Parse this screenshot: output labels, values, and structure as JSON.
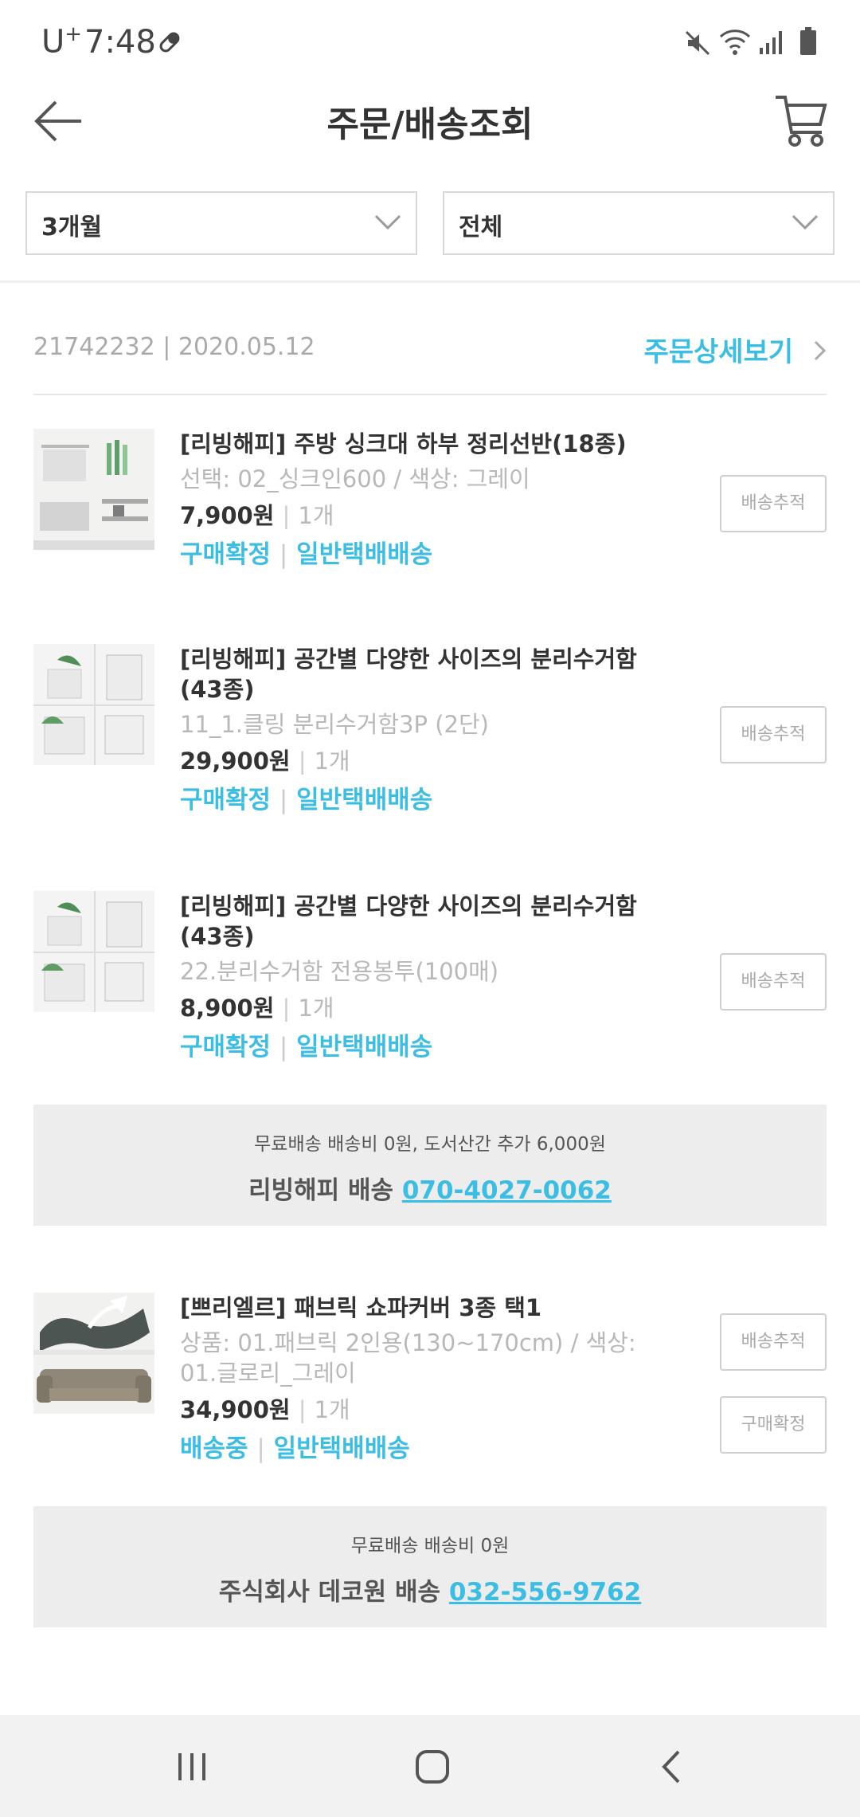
{
  "status_bar": {
    "carrier": "U",
    "carrier_sup": "+",
    "time": "7:48"
  },
  "header": {
    "title": "주문/배송조회"
  },
  "filters": {
    "period": "3개월",
    "type": "전체"
  },
  "order": {
    "info": "21742232 | 2020.05.12",
    "detail_link": "주문상세보기"
  },
  "items": [
    {
      "name": "[리빙해피] 주방 싱크대 하부 정리선반(18종)",
      "name2": "",
      "option": "선택: 02_싱크인600 / 색상: 그레이",
      "option2": "",
      "price": "7,900원",
      "qty": "1개",
      "status": "구매확정",
      "ship": "일반택배배송",
      "btn1": "배송추적",
      "btn2": ""
    },
    {
      "name": "[리빙해피] 공간별 다양한 사이즈의 분리수거함",
      "name2": "(43종)",
      "option": "11_1.클링 분리수거함3P (2단)",
      "option2": "",
      "price": "29,900원",
      "qty": "1개",
      "status": "구매확정",
      "ship": "일반택배배송",
      "btn1": "배송추적",
      "btn2": ""
    },
    {
      "name": "[리빙해피] 공간별 다양한 사이즈의 분리수거함",
      "name2": "(43종)",
      "option": "22.분리수거함 전용봉투(100매)",
      "option2": "",
      "price": "8,900원",
      "qty": "1개",
      "status": "구매확정",
      "ship": "일반택배배송",
      "btn1": "배송추적",
      "btn2": ""
    },
    {
      "name": "[쁘리엘르] 패브릭 쇼파커버 3종 택1",
      "name2": "",
      "option": "상품: 01.패브릭 2인용(130~170cm) / 색상:",
      "option2": "01.글로리_그레이",
      "price": "34,900원",
      "qty": "1개",
      "status": "배송중",
      "ship": "일반택배배송",
      "btn1": "배송추적",
      "btn2": "구매확정"
    }
  ],
  "shipping": [
    {
      "fee": "무료배송 배송비 0원, 도서산간 추가 6,000원",
      "seller": "리빙해피 배송",
      "phone": "070-4027-0062"
    },
    {
      "fee": "무료배송 배송비 0원",
      "seller": "주식회사 데코원 배송",
      "phone": "032-556-9762"
    }
  ],
  "colors": {
    "accent": "#3bbde4",
    "text": "#333333",
    "muted": "#b8b8b8",
    "box": "#ededed"
  }
}
